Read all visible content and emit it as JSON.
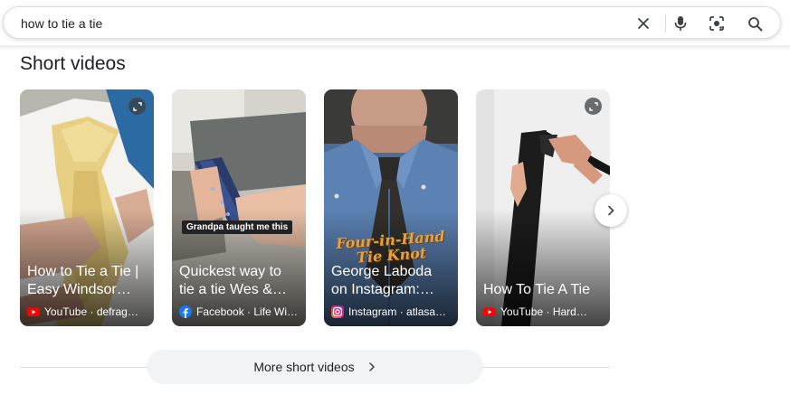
{
  "search": {
    "query": "how to tie a tie"
  },
  "icons": {
    "clear": "close-icon",
    "voice": "microphone-icon",
    "lens": "camera-lens-icon",
    "search": "search-icon"
  },
  "section": {
    "title": "Short videos"
  },
  "videos": [
    {
      "title": "How to Tie a Tie | Easy Windsor…",
      "source_label": "YouTube · defrag…",
      "platform": "youtube",
      "overlay_text": ""
    },
    {
      "title": "Quickest way to tie a tie Wes &…",
      "source_label": "Facebook · Life Wi…",
      "platform": "facebook",
      "overlay_text": "Grandpa taught me this"
    },
    {
      "title": "George Laboda on Instagram:…",
      "source_label": "Instagram · atlasa…",
      "platform": "instagram",
      "overlay_text": "Four-in-Hand Tie Knot"
    },
    {
      "title": "How To Tie A Tie",
      "source_label": "YouTube · Hard…",
      "platform": "youtube",
      "overlay_text": ""
    }
  ],
  "more": {
    "label": "More short videos"
  },
  "colors": {
    "youtube": "#ff0000",
    "facebook": "#1877f2",
    "instagram_start": "#f58529",
    "instagram_end": "#8134af",
    "button_bg": "#f1f3f4",
    "text": "#202124"
  }
}
